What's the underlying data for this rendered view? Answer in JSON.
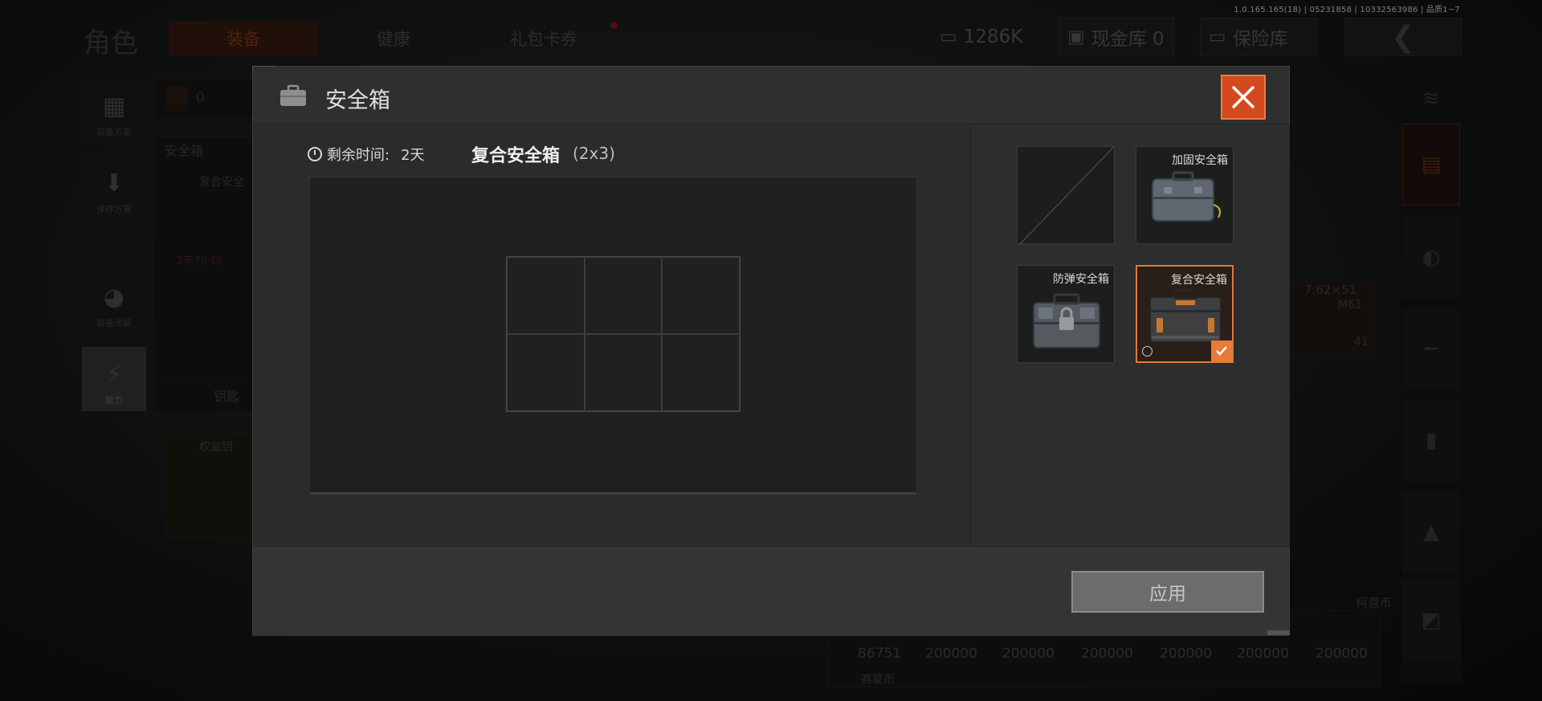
{
  "version": "1.0.165.165(18) | 05231858 | 10332563986 | 品质1~7",
  "background": {
    "title": "角色",
    "tabs": [
      "装备",
      "健康",
      "礼包卡券"
    ],
    "resources": {
      "money": "1286K",
      "cash_vault": "现金库 0",
      "insurance": "保险库"
    },
    "side_buttons": [
      "装备方案",
      "保存方案",
      "装备涂装",
      "能力"
    ],
    "panel_labels": {
      "safe_box": "安全箱",
      "safe_box_item": "复合安全",
      "timer": "2天7小时",
      "key": "钥匙",
      "rights": "权益钥",
      "count": "0",
      "ammo": "7.62×51",
      "ammo_name": "M61",
      "ammo_count": "41",
      "coin": "柯恩币",
      "coin_bottom": "赛蒙币"
    },
    "bottom_values": [
      "86751",
      "200000",
      "200000",
      "200000",
      "200000",
      "200000",
      "200000"
    ]
  },
  "modal": {
    "title": "安全箱",
    "timer_label": "剩余时间:",
    "timer_value": "2天",
    "case_name": "复合安全箱",
    "case_size": "(2x3)",
    "grid": {
      "rows": 2,
      "cols": 3
    },
    "options": [
      {
        "label": "",
        "state": "empty"
      },
      {
        "label": "加固安全箱",
        "state": "available"
      },
      {
        "label": "防弹安全箱",
        "state": "locked"
      },
      {
        "label": "复合安全箱",
        "state": "selected"
      }
    ],
    "apply_label": "应用"
  },
  "colors": {
    "accent": "#e07a3a",
    "close_bg": "#d44a1f",
    "modal_bg": "#2b2c2c"
  }
}
